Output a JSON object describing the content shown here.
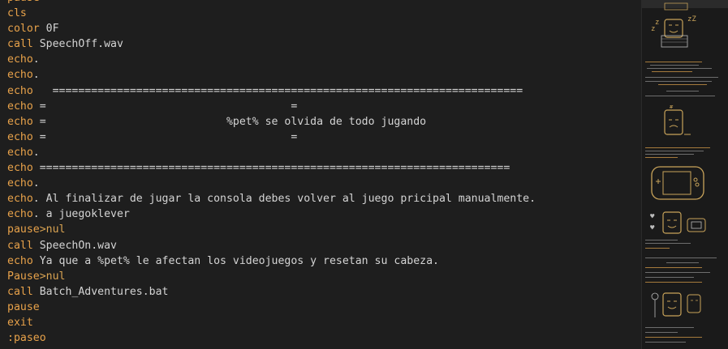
{
  "editor": {
    "lines": [
      {
        "kw": "pause",
        "text": ""
      },
      {
        "kw": "cls",
        "text": ""
      },
      {
        "kw": "color",
        "text": " 0F"
      },
      {
        "kw": "call",
        "text": " SpeechOff.wav"
      },
      {
        "kw": "echo",
        "text": "."
      },
      {
        "kw": "echo",
        "text": "."
      },
      {
        "kw": "echo",
        "text": "   ========================================================================="
      },
      {
        "kw": "echo",
        "text": " =                                      ="
      },
      {
        "kw": "echo",
        "text": " =                            %pet% se olvida de todo jugando"
      },
      {
        "kw": "echo",
        "text": " =                                      ="
      },
      {
        "kw": "echo",
        "text": "."
      },
      {
        "kw": "echo",
        "text": " ========================================================================="
      },
      {
        "kw": "echo",
        "text": "."
      },
      {
        "kw": "echo",
        "text": ". Al finalizar de jugar la consola debes volver al juego pricipal manualmente."
      },
      {
        "kw": "echo",
        "text": ". a juegoklever"
      },
      {
        "kw": "pause",
        "redir": ">nul",
        "text": ""
      },
      {
        "kw": "call",
        "text": " SpeechOn.wav"
      },
      {
        "kw": "echo",
        "text": " Ya que a %pet% le afectan los videojuegos y resetan su cabeza."
      },
      {
        "kw": "Pause",
        "redir": ">nul",
        "text": ""
      },
      {
        "kw": "call",
        "text": " Batch_Adventures.bat"
      },
      {
        "kw": "pause",
        "text": ""
      },
      {
        "kw": "exit",
        "text": ""
      },
      {
        "label": ":paseo",
        "text": ""
      }
    ]
  },
  "minimap": {
    "art_color": "#c9a45a",
    "text_color": "#7a7a7a"
  }
}
